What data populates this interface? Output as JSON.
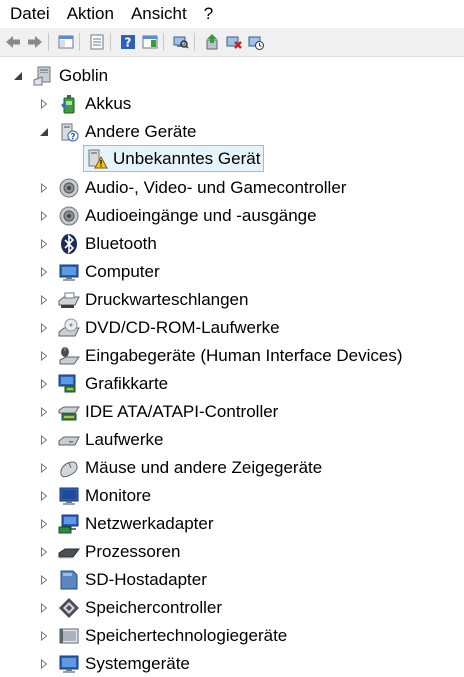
{
  "menu": [
    "Datei",
    "Aktion",
    "Ansicht",
    "?"
  ],
  "toolbar": {
    "icons": [
      "back-icon",
      "forward-icon",
      "show-hide-console-tree-icon",
      "properties-icon",
      "help-icon",
      "action-pane-icon",
      "scan-hardware-icon",
      "update-driver-icon",
      "uninstall-icon",
      "disable-device-icon"
    ]
  },
  "tree": {
    "root": {
      "label": "Goblin",
      "icon": "computer-icon"
    },
    "other_devices": {
      "label": "Andere Geräte",
      "icon": "unknown-device-icon"
    },
    "unknown_device": {
      "label": "Unbekanntes Gerät",
      "icon": "warning-device-icon"
    },
    "items": [
      {
        "label": "Akkus",
        "icon": "battery-icon"
      },
      {
        "label": "Audio-, Video- und Gamecontroller",
        "icon": "speaker-icon"
      },
      {
        "label": "Audioeingänge und -ausgänge",
        "icon": "speaker-icon"
      },
      {
        "label": "Bluetooth",
        "icon": "bluetooth-icon"
      },
      {
        "label": "Computer",
        "icon": "monitor-icon"
      },
      {
        "label": "Druckwarteschlangen",
        "icon": "printer-icon"
      },
      {
        "label": "DVD/CD-ROM-Laufwerke",
        "icon": "dvd-drive-icon"
      },
      {
        "label": "Eingabegeräte (Human Interface Devices)",
        "icon": "hid-icon"
      },
      {
        "label": "Grafikkarte",
        "icon": "display-adapter-icon"
      },
      {
        "label": "IDE ATA/ATAPI-Controller",
        "icon": "ide-controller-icon"
      },
      {
        "label": "Laufwerke",
        "icon": "disk-drive-icon"
      },
      {
        "label": "Mäuse und andere Zeigegeräte",
        "icon": "mouse-icon"
      },
      {
        "label": "Monitore",
        "icon": "monitor-icon"
      },
      {
        "label": "Netzwerkadapter",
        "icon": "network-adapter-icon"
      },
      {
        "label": "Prozessoren",
        "icon": "processor-icon"
      },
      {
        "label": "SD-Hostadapter",
        "icon": "sd-host-icon"
      },
      {
        "label": "Speichercontroller",
        "icon": "storage-controller-icon"
      },
      {
        "label": "Speichertechnologiegeräte",
        "icon": "memory-technology-icon"
      },
      {
        "label": "Systemgeräte",
        "icon": "system-devices-icon"
      }
    ]
  }
}
